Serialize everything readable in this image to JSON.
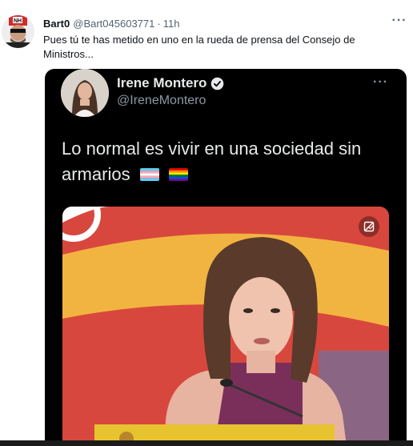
{
  "tweet": {
    "author_name": "Bart0",
    "handle": "@Bart045603771",
    "separator": "·",
    "time": "11h",
    "text": "Pues tú te has metido en uno en la rueda de prensa del Consejo de Ministros...",
    "more_icon": "more-horizontal-icon"
  },
  "embedded": {
    "author_name": "Irene Montero",
    "handle": "@IreneMontero",
    "verified_icon": "verified-badge-icon",
    "text": "Lo normal es vivir en una sociedad sin armarios",
    "emojis": [
      "transgender-flag",
      "rainbow-flag"
    ],
    "media_icon": "media-settings-icon"
  },
  "colors": {
    "text_primary": "#0f1419",
    "text_secondary": "#536471",
    "embed_bg": "#000000",
    "verified": "#1d9bf0"
  }
}
